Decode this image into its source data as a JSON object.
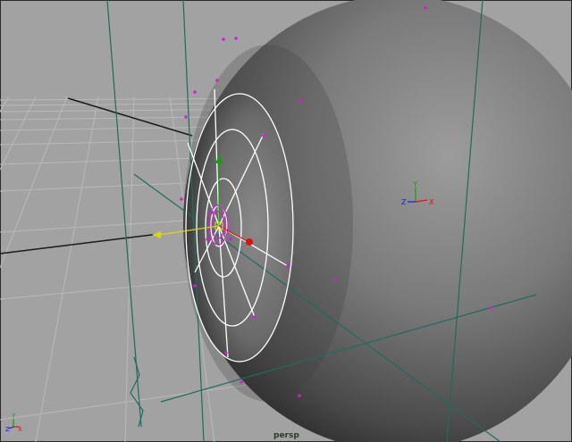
{
  "viewport": {
    "camera_name": "persp",
    "background_color": "#a2a2a2",
    "grid_color": "#b9b9b9",
    "selection_color": "#ffffff",
    "component_color": "#d020d0",
    "construction_line_color": "#1f6b5f"
  },
  "axis_labels": {
    "x": "X",
    "y": "Y",
    "z": "Z"
  },
  "axis_colors": {
    "x": "#e01010",
    "y": "#10a010",
    "z": "#1020e0"
  },
  "objects": [
    {
      "name": "eyeball-sphere",
      "shading": "smooth-grey"
    },
    {
      "name": "iris-wireframe",
      "state": "selected"
    }
  ]
}
